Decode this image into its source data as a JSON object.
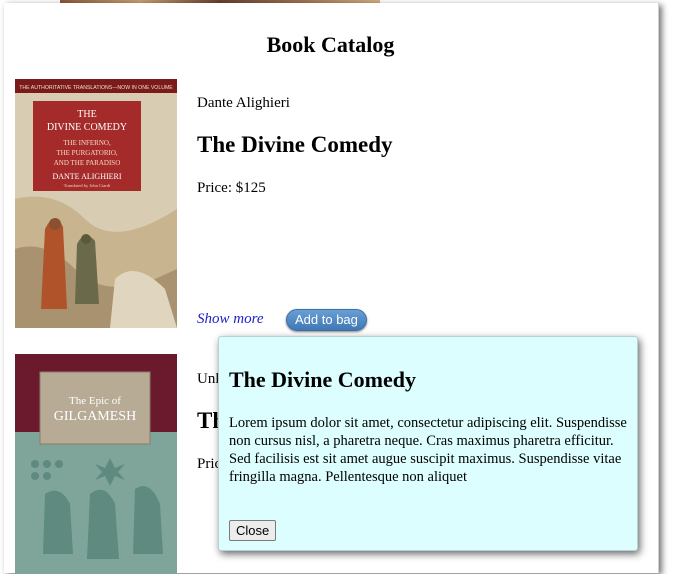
{
  "page": {
    "title": "Book Catalog"
  },
  "books": [
    {
      "author": "Dante Alighieri",
      "title": "The Divine Comedy",
      "price": "Price: $125",
      "show_more": "Show more",
      "add_to_bag": "Add to bag",
      "cover": {
        "banner": "THE AUTHORITATIVE TRANSLATIONS—NOW IN ONE VOLUME",
        "line1": "THE",
        "line2": "DIVINE COMEDY",
        "sub1": "THE INFERNO,",
        "sub2": "THE PURGATORIO,",
        "sub3": "AND THE PARADISO",
        "author": "DANTE ALIGHIERI",
        "translator": "Translated by John Ciardi"
      }
    },
    {
      "author": "Unk",
      "title": "Th",
      "price": "Pric",
      "cover": {
        "line1": "The Epic of",
        "line2": "GILGAMESH"
      }
    }
  ],
  "modal": {
    "title": "The Divine Comedy",
    "body": "Lorem ipsum dolor sit amet, consectetur adipiscing elit. Suspendisse non cursus nisl, a pharetra neque. Cras maximus pharetra efficitur. Sed facilisis est sit amet augue suscipit maximus. Suspendisse vitae fringilla magna. Pellentesque non aliquet",
    "close_label": "Close"
  }
}
